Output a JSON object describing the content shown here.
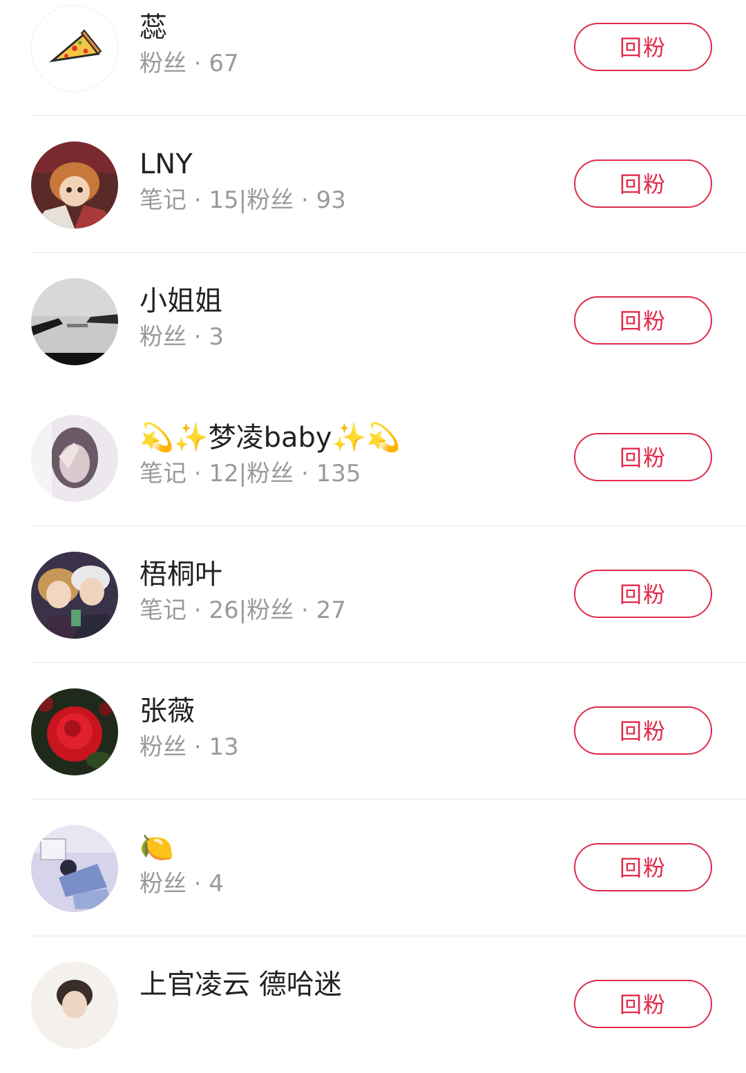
{
  "follow_button_label": "回粉",
  "colors": {
    "accent": "#e0294a",
    "name_text": "#222222",
    "stats_text": "#9a9a9a",
    "divider": "#e6e6e6"
  },
  "users": [
    {
      "name": "蕊",
      "stats": "粉丝 · 67",
      "avatar_icon": "pizza-slice-icon"
    },
    {
      "name": "LNY",
      "stats": "笔记 · 15|粉丝 · 93",
      "avatar_icon": "anime-character-avatar"
    },
    {
      "name": "小姐姐",
      "stats": "粉丝 · 3",
      "avatar_icon": "reaching-hands-avatar"
    },
    {
      "name": "💫✨梦凌baby✨💫",
      "stats": "笔记 · 12|粉丝 · 135",
      "avatar_icon": "hand-over-face-avatar"
    },
    {
      "name": "梧桐叶",
      "stats": "笔记 · 26|粉丝 · 27",
      "avatar_icon": "anime-duo-avatar"
    },
    {
      "name": "张薇",
      "stats": "粉丝 · 13",
      "avatar_icon": "red-rose-avatar"
    },
    {
      "name": "🍋",
      "stats": "粉丝 · 4",
      "avatar_icon": "person-lying-avatar"
    },
    {
      "name": "上官凌云 德哈迷",
      "stats": "",
      "avatar_icon": "person-portrait-avatar"
    }
  ]
}
